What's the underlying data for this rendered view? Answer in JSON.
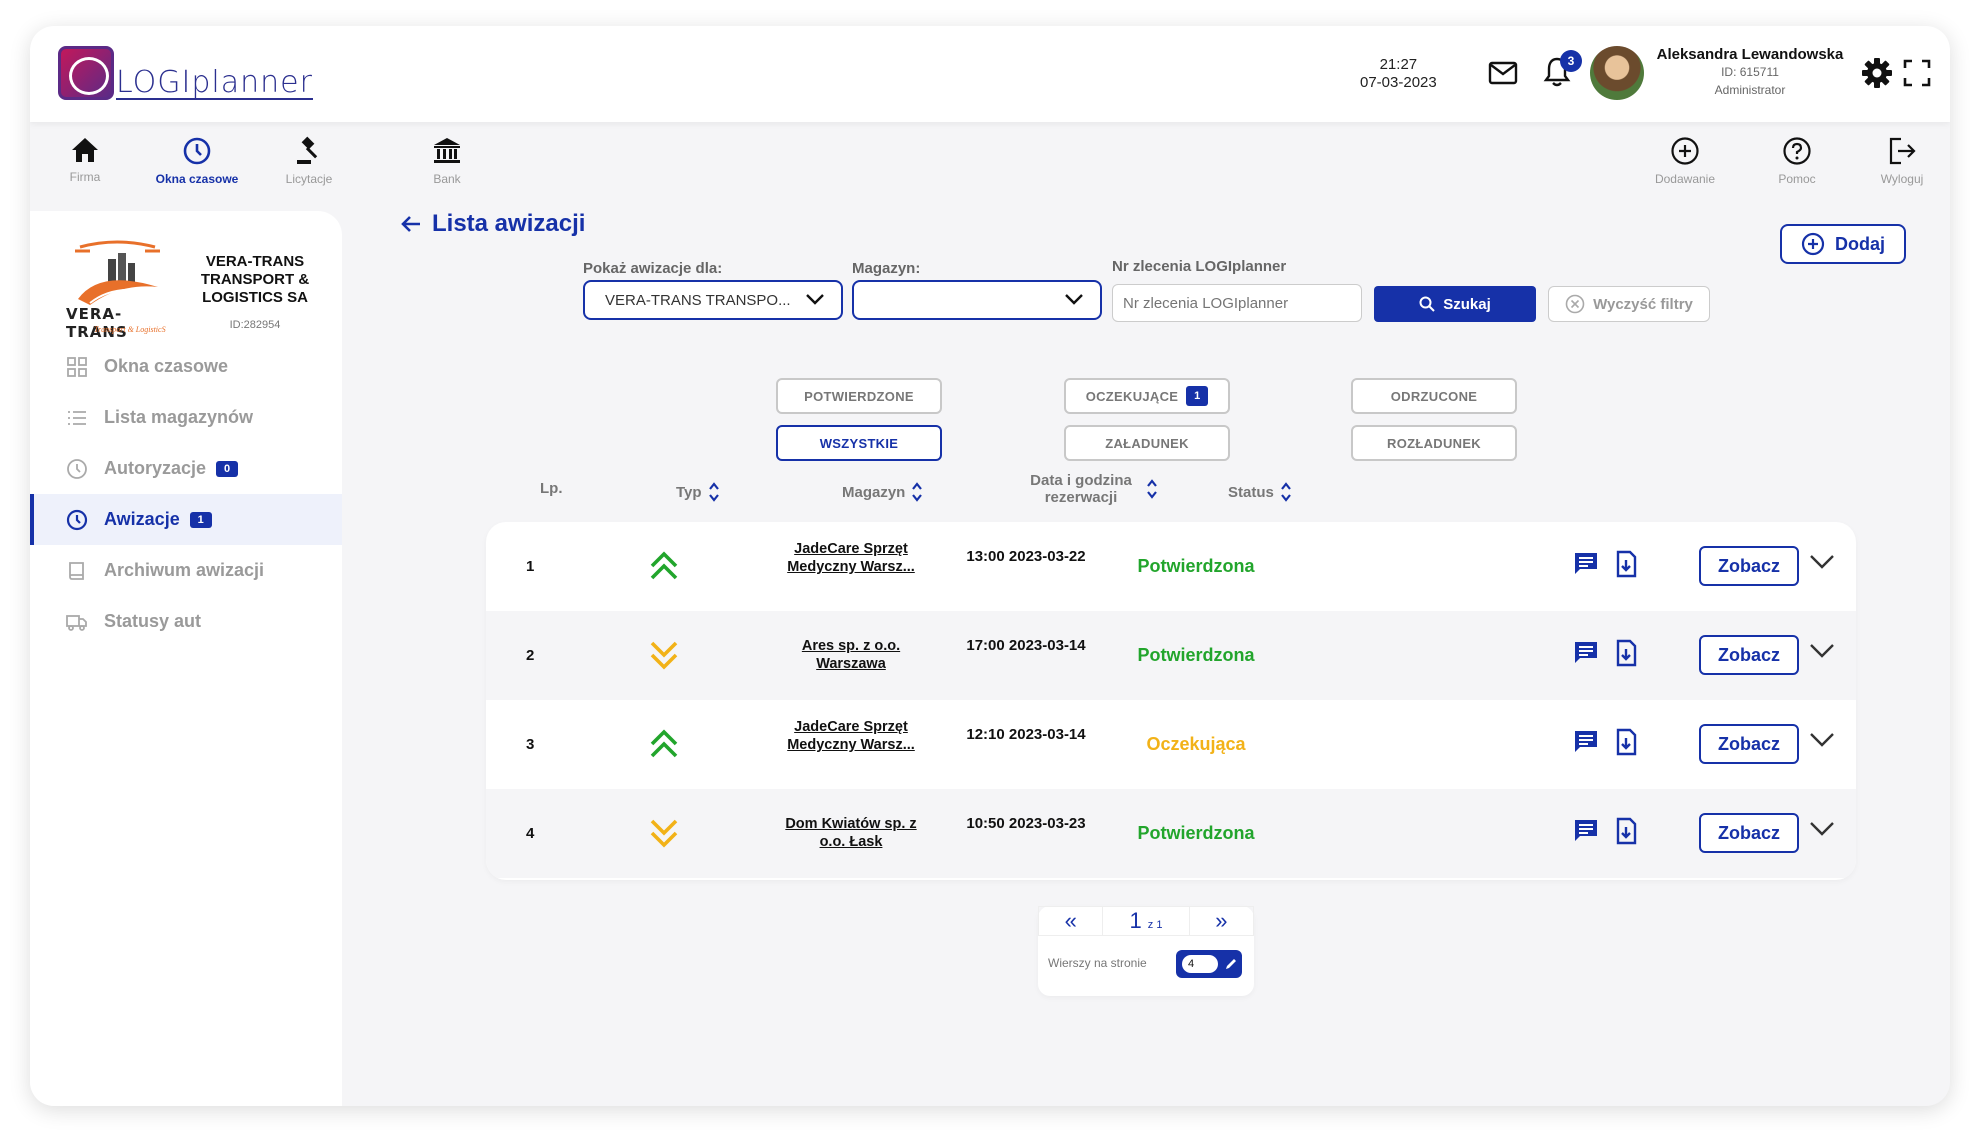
{
  "app": {
    "logo_text": "LOGIplanner"
  },
  "header": {
    "time": "21:27",
    "date": "07-03-2023",
    "notifications_count": "3",
    "user": {
      "name": "Aleksandra Lewandowska",
      "id": "ID: 615711",
      "role": "Administrator"
    }
  },
  "nav": {
    "left": [
      {
        "label": "Firma",
        "icon": "home-icon"
      },
      {
        "label": "Okna czasowe",
        "icon": "clock-icon",
        "active": true
      },
      {
        "label": "Licytacje",
        "icon": "gavel-icon"
      },
      {
        "label": "Bank",
        "icon": "bank-icon"
      }
    ],
    "right": [
      {
        "label": "Dodawanie",
        "icon": "plus-circle-icon"
      },
      {
        "label": "Pomoc",
        "icon": "help-icon"
      },
      {
        "label": "Wyloguj",
        "icon": "logout-icon"
      }
    ]
  },
  "company": {
    "name": "VERA-TRANS TRANSPORT & LOGISTICS SA",
    "id": "ID:282954",
    "logo_text": "VERA-TRANS",
    "logo_sub": "Transport & LogisticS"
  },
  "sidebar": {
    "items": [
      {
        "label": "Okna czasowe",
        "icon": "grid-icon"
      },
      {
        "label": "Lista magazynów",
        "icon": "list-icon"
      },
      {
        "label": "Autoryzacje",
        "icon": "clock-icon",
        "badge": "0"
      },
      {
        "label": "Awizacje",
        "icon": "clock-icon",
        "badge": "1",
        "active": true
      },
      {
        "label": "Archiwum awizacji",
        "icon": "book-icon"
      },
      {
        "label": "Statusy aut",
        "icon": "truck-icon"
      }
    ]
  },
  "page": {
    "title": "Lista awizacji",
    "add_label": "Dodaj"
  },
  "filters": {
    "show_for_label": "Pokaż awizacje dla:",
    "show_for_value": "VERA-TRANS TRANSPO...",
    "warehouse_label": "Magazyn:",
    "warehouse_value": "",
    "order_label": "Nr zlecenia LOGIplanner",
    "order_placeholder": "Nr zlecenia LOGIplanner",
    "search_label": "Szukaj",
    "clear_label": "Wyczyść filtry"
  },
  "status_filters": {
    "confirmed": "POTWIERDZONE",
    "pending": "OCZEKUJĄCE",
    "pending_badge": "1",
    "rejected": "ODRZUCONE",
    "all": "WSZYSTKIE",
    "loading": "ZAŁADUNEK",
    "unloading": "ROZŁADUNEK"
  },
  "table": {
    "headers": {
      "lp": "Lp.",
      "typ": "Typ",
      "magazyn": "Magazyn",
      "data": "Data i godzina rezerwacji",
      "status": "Status"
    },
    "view_label": "Zobacz",
    "rows": [
      {
        "lp": "1",
        "typ": "up",
        "magazyn": "JadeCare Sprzęt Medyczny Warsz...",
        "data": "13:00 2023-03-22",
        "status": "Potwierdzona",
        "status_color": "#22a52c"
      },
      {
        "lp": "2",
        "typ": "down",
        "magazyn": "Ares sp. z o.o. Warszawa",
        "data": "17:00 2023-03-14",
        "status": "Potwierdzona",
        "status_color": "#22a52c"
      },
      {
        "lp": "3",
        "typ": "up",
        "magazyn": "JadeCare Sprzęt Medyczny Warsz...",
        "data": "12:10 2023-03-14",
        "status": "Oczekująca",
        "status_color": "#f2b218"
      },
      {
        "lp": "4",
        "typ": "down",
        "magazyn": "Dom Kwiatów sp. z o.o. Łask",
        "data": "10:50 2023-03-23",
        "status": "Potwierdzona",
        "status_color": "#22a52c"
      }
    ]
  },
  "pagination": {
    "prev": "«",
    "page": "1",
    "of": "z 1",
    "next": "»",
    "rows_label": "Wierszy na stronie",
    "rows_value": "4"
  },
  "colors": {
    "accent": "#1631a8",
    "up": "#22a52c",
    "down": "#f2b218"
  }
}
